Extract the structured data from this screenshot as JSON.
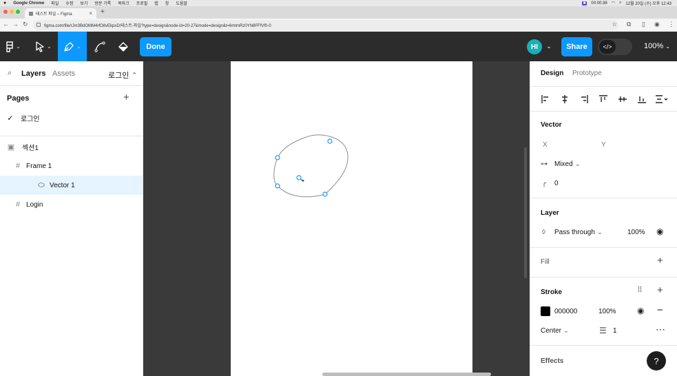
{
  "menubar": {
    "app": "Google Chrome",
    "items": [
      "파일",
      "수정",
      "보기",
      "방문 기록",
      "북마크",
      "프로필",
      "탭",
      "창",
      "도움말"
    ],
    "recording": "00:00:38",
    "clock": "12월 20일 (수) 오후 12:43"
  },
  "browser": {
    "tab_title": "테스트 파일 – Figma",
    "url": "figma.com/file/rJm3BdOMM4rfO8vEkpsD/테스트-파일?type=design&node-id=20-27&mode=design&t=6mtmRz0YN8FFfVf0-0"
  },
  "toolbar": {
    "done_label": "Done",
    "share_label": "Share",
    "avatar_initials": "HI",
    "zoom": "100%",
    "dev_mode_label": "</>"
  },
  "left_panel": {
    "tabs": {
      "layers": "Layers",
      "assets": "Assets",
      "page_dropdown": "로그인"
    },
    "pages_title": "Pages",
    "pages": [
      {
        "name": "로그인",
        "selected": true
      }
    ],
    "layers": [
      {
        "name": "섹션1",
        "kind": "section-icon",
        "indent": 0,
        "selected": false
      },
      {
        "name": "Frame 1",
        "kind": "frame-icon",
        "indent": 1,
        "selected": false
      },
      {
        "name": "Vector 1",
        "kind": "vector-icon",
        "indent": 2,
        "selected": true
      },
      {
        "name": "Login",
        "kind": "frame-icon",
        "indent": 1,
        "selected": false
      }
    ]
  },
  "right_panel": {
    "tabs": {
      "design": "Design",
      "prototype": "Prototype"
    },
    "vector": {
      "title": "Vector",
      "x_label": "X",
      "y_label": "Y",
      "mirroring": "Mixed",
      "corner_radius": "0"
    },
    "layer": {
      "title": "Layer",
      "blend_mode": "Pass through",
      "opacity": "100%"
    },
    "fill": {
      "title": "Fill"
    },
    "stroke": {
      "title": "Stroke",
      "color_hex": "000000",
      "opacity": "100%",
      "position": "Center",
      "weight": "1"
    },
    "effects": {
      "title": "Effects"
    },
    "help_label": "?"
  },
  "colors": {
    "accent": "#0d99ff",
    "toolbar_bg": "#2c2c2c",
    "canvas_bg": "#3a3a3a",
    "selection_bg": "#e5f4ff",
    "avatar": "#18b0b8",
    "stroke_swatch": "#000000"
  }
}
